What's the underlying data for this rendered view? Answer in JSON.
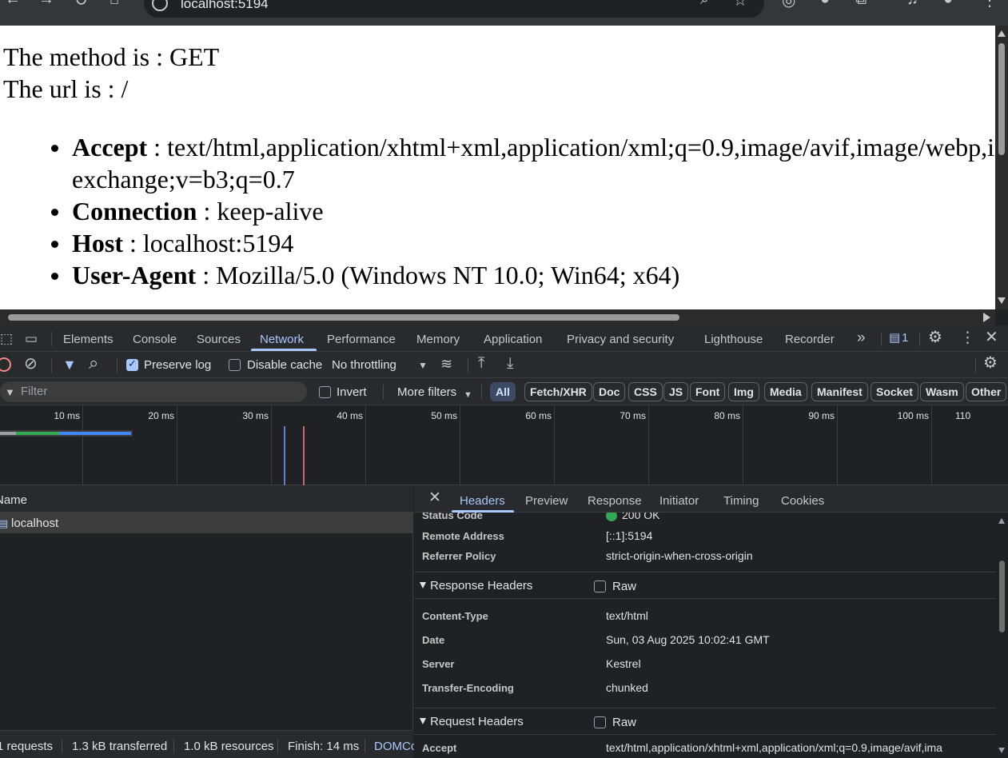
{
  "browser": {
    "url": "localhost:5194"
  },
  "page": {
    "method_line": "The method is : GET",
    "url_line": "The url is : /",
    "headers": [
      {
        "name": "Accept",
        "value": " : text/html,application/xhtml+xml,application/xml;q=0.9,image/avif,image/webp,im",
        "continuation": "exchange;v=b3;q=0.7"
      },
      {
        "name": "Connection",
        "value": " : keep-alive"
      },
      {
        "name": "Host",
        "value": " : localhost:5194"
      },
      {
        "name": "User-Agent",
        "value": " : Mozilla/5.0 (Windows NT 10.0; Win64; x64)"
      }
    ]
  },
  "devtools": {
    "tabs": [
      "Elements",
      "Console",
      "Sources",
      "Network",
      "Performance",
      "Memory",
      "Application",
      "Privacy and security",
      "Lighthouse",
      "Recorder"
    ],
    "active_tab": "Network",
    "issues_count": "1",
    "toolbar": {
      "preserve_log": "Preserve log",
      "preserve_log_checked": true,
      "disable_cache": "Disable cache",
      "disable_cache_checked": false,
      "throttling": "No throttling"
    },
    "filter": {
      "placeholder": "Filter",
      "invert": "Invert",
      "more_filters": "More filters",
      "types": [
        "All",
        "Fetch/XHR",
        "Doc",
        "CSS",
        "JS",
        "Font",
        "Img",
        "Media",
        "Manifest",
        "Socket",
        "Wasm",
        "Other"
      ],
      "selected_type": "All"
    },
    "timeline": {
      "ticks": [
        "10 ms",
        "20 ms",
        "30 ms",
        "40 ms",
        "50 ms",
        "60 ms",
        "70 ms",
        "80 ms",
        "90 ms",
        "100 ms",
        "110"
      ]
    },
    "request_list": {
      "name_header": "Name",
      "rows": [
        "localhost"
      ]
    },
    "details": {
      "tabs": [
        "Headers",
        "Preview",
        "Response",
        "Initiator",
        "Timing",
        "Cookies"
      ],
      "active_tab": "Headers",
      "general": [
        {
          "key": "Status Code",
          "value": "200 OK"
        },
        {
          "key": "Remote Address",
          "value": "[::1]:5194"
        },
        {
          "key": "Referrer Policy",
          "value": "strict-origin-when-cross-origin"
        }
      ],
      "response_headers_title": "Response Headers",
      "raw_label": "Raw",
      "response_headers": [
        {
          "key": "Content-Type",
          "value": "text/html"
        },
        {
          "key": "Date",
          "value": "Sun, 03 Aug 2025 10:02:41 GMT"
        },
        {
          "key": "Server",
          "value": "Kestrel"
        },
        {
          "key": "Transfer-Encoding",
          "value": "chunked"
        }
      ],
      "request_headers_title": "Request Headers",
      "request_headers": [
        {
          "key": "Accept",
          "value": "text/html,application/xhtml+xml,application/xml;q=0.9,image/avif,ima"
        }
      ]
    },
    "status_bar": {
      "requests": "1 requests",
      "transferred": "1.3 kB transferred",
      "resources": "1.0 kB resources",
      "finish": "Finish: 14 ms",
      "domcontent": "DOMCo"
    },
    "colors": {
      "accent": "#a8c7fa",
      "status_ok": "#34a853",
      "panel_bg": "#202124"
    }
  }
}
